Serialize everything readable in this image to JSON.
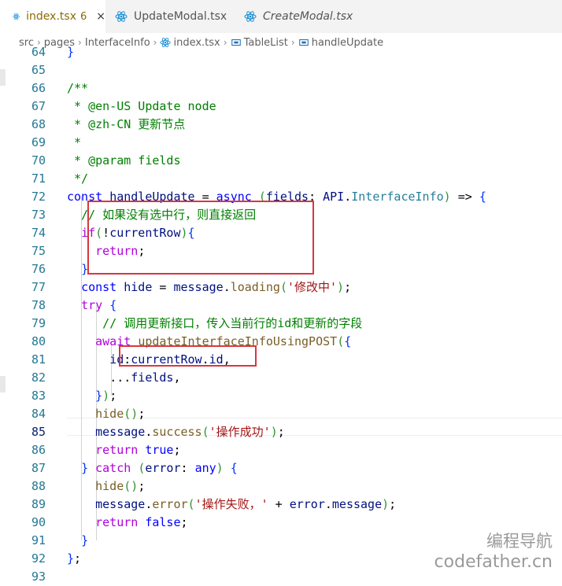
{
  "tabs": [
    {
      "label": "index.tsx",
      "badge": "6",
      "close": "×",
      "active": true
    },
    {
      "label": "UpdateModal.tsx",
      "active": false
    },
    {
      "label": "CreateModal.tsx",
      "active": false,
      "italic": true
    }
  ],
  "breadcrumb": [
    "src",
    "pages",
    "InterfaceInfo",
    "index.tsx",
    "TableList",
    "handleUpdate"
  ],
  "lines": [
    {
      "n": "64",
      "code": "}"
    },
    {
      "n": "65",
      "code": ""
    },
    {
      "n": "66",
      "code": "/**"
    },
    {
      "n": "67",
      "code": " * @en-US Update node"
    },
    {
      "n": "68",
      "code": " * @zh-CN 更新节点"
    },
    {
      "n": "69",
      "code": " *"
    },
    {
      "n": "70",
      "code": " * @param fields"
    },
    {
      "n": "71",
      "code": " */"
    },
    {
      "n": "72",
      "code": "const handleUpdate = async (fields: API.InterfaceInfo) => {"
    },
    {
      "n": "73",
      "code": "  // 如果没有选中行，则直接返回"
    },
    {
      "n": "74",
      "code": "  if(!currentRow){"
    },
    {
      "n": "75",
      "code": "    return;"
    },
    {
      "n": "76",
      "code": "  }"
    },
    {
      "n": "77",
      "code": "  const hide = message.loading('修改中');"
    },
    {
      "n": "78",
      "code": "  try {"
    },
    {
      "n": "79",
      "code": "     // 调用更新接口，传入当前行的id和更新的字段"
    },
    {
      "n": "80",
      "code": "    await updateInterfaceInfoUsingPOST({"
    },
    {
      "n": "81",
      "code": "      id:currentRow.id,"
    },
    {
      "n": "82",
      "code": "      ...fields,"
    },
    {
      "n": "83",
      "code": "    });"
    },
    {
      "n": "84",
      "code": "    hide();"
    },
    {
      "n": "85",
      "code": "    message.success('操作成功');"
    },
    {
      "n": "86",
      "code": "    return true;"
    },
    {
      "n": "87",
      "code": "  } catch (error: any) {"
    },
    {
      "n": "88",
      "code": "    hide();"
    },
    {
      "n": "89",
      "code": "    message.error('操作失败，' + error.message);"
    },
    {
      "n": "90",
      "code": "    return false;"
    },
    {
      "n": "91",
      "code": "  }"
    },
    {
      "n": "92",
      "code": "};"
    },
    {
      "n": "93",
      "code": ""
    }
  ],
  "watermark": {
    "line1": "编程导航",
    "line2": "codefather.cn"
  },
  "colors": {
    "keyword": "#0000ff",
    "control": "#af00db",
    "function": "#795e26",
    "variable": "#001080",
    "type": "#267f99",
    "string": "#a31515",
    "comment": "#008000",
    "highlight_box": "#d9363e"
  }
}
